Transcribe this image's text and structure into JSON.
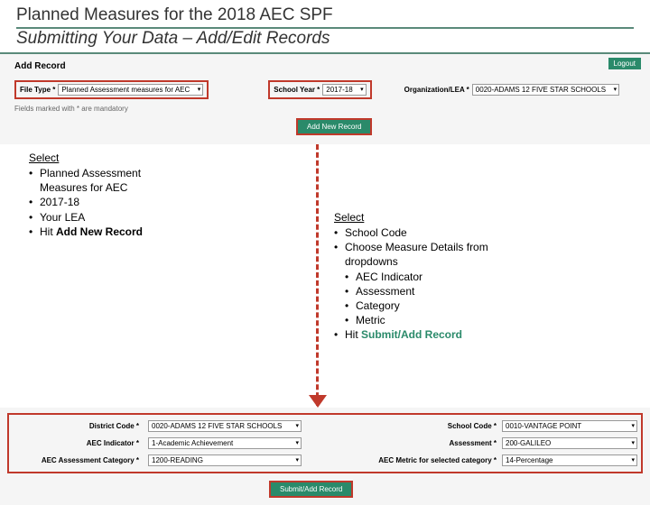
{
  "header": {
    "title1": "Planned Measures for the 2018 AEC SPF",
    "title2": "Submitting Your Data – Add/Edit Records"
  },
  "top": {
    "logout": "Logout",
    "addRecord": "Add Record",
    "fileTypeLabel": "File Type *",
    "fileTypeValue": "Planned Assessment measures for AEC",
    "schoolYearLabel": "School Year *",
    "schoolYearValue": "2017-18",
    "orgLabel": "Organization/LEA *",
    "orgValue": "0020-ADAMS 12 FIVE STAR SCHOOLS",
    "mandatory": "Fields marked with * are mandatory",
    "addNewBtn": "Add New Record"
  },
  "left": {
    "head": "Select",
    "b1a": "Planned Assessment",
    "b1b": "Measures for AEC",
    "b2": "2017-18",
    "b3": "Your LEA",
    "b4pre": "Hit ",
    "b4bold": "Add New Record"
  },
  "right": {
    "head": "Select",
    "b1": "School Code",
    "b2a": "Choose Measure Details from",
    "b2b": "dropdowns",
    "s1": "AEC Indicator",
    "s2": "Assessment",
    "s3": "Category",
    "s4": "Metric",
    "b3pre": "Hit ",
    "b3bold": "Submit/Add Record"
  },
  "bottom": {
    "districtLabel": "District Code *",
    "districtValue": "0020-ADAMS 12 FIVE STAR SCHOOLS",
    "schoolCodeLabel": "School Code *",
    "schoolCodeValue": "0010-VANTAGE POINT",
    "aecIndLabel": "AEC Indicator *",
    "aecIndValue": "1-Academic Achievement",
    "assessLabel": "Assessment *",
    "assessValue": "200-GALILEO",
    "catLabel": "AEC Assessment Category *",
    "catValue": "1200-READING",
    "metricLabel": "AEC Metric for selected category *",
    "metricValue": "14-Percentage",
    "submitBtn": "Submit/Add Record"
  }
}
